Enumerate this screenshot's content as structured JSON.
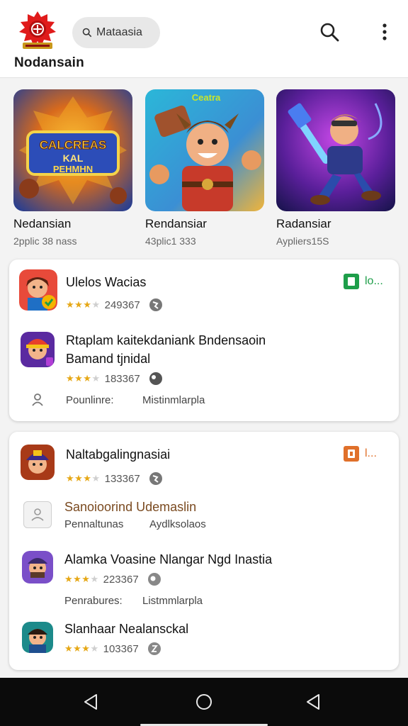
{
  "header": {
    "brand": "Nodansain",
    "search_text": "Mataasia"
  },
  "featured": [
    {
      "title": "Nedansian",
      "subtitle": "2pplic 38 nass",
      "art_text": "CALCREAS KAL PEHMHN"
    },
    {
      "title": "Rendansiar",
      "subtitle": "43plic1 333",
      "art_text": "Ceatra"
    },
    {
      "title": "Radansiar",
      "subtitle": "Aypliers15S",
      "art_text": ""
    }
  ],
  "card1": {
    "badge": {
      "label": "lo...",
      "color": "#1e9e4a"
    },
    "items": [
      {
        "title": "Ulelos Wacias",
        "rating": "249367"
      },
      {
        "title_line1": "Rtaplam kaitekdaniank Bndensaoin",
        "title_line2": "Bamand tjnidal",
        "rating": "183367"
      }
    ],
    "footer": {
      "label": "Pounlinre:",
      "value": "Mistinmlarpla"
    }
  },
  "card2": {
    "badge": {
      "label": "l...",
      "color": "#e0702a"
    },
    "items": [
      {
        "title": "Naltabgalingnasiai",
        "rating": "133367"
      },
      {
        "title": "Sanoioorind Udemaslin",
        "meta_left": "Pennaltunas",
        "meta_right": "Aydlksolaos"
      },
      {
        "title": "Alamka Voasine Nlangar Ngd Inastia",
        "rating": "223367",
        "meta_left": "Penrabures:",
        "meta_right": "Listmmlarpla"
      },
      {
        "title": "Slanhaar Nealansckal",
        "rating": "103367"
      }
    ]
  },
  "colors": {
    "star": "#e6a817",
    "navbar": "#0b0b0b"
  },
  "icons": [
    "search-icon",
    "more-vert-icon",
    "globe-icon",
    "person-icon",
    "back-icon",
    "home-icon",
    "recents-icon"
  ]
}
